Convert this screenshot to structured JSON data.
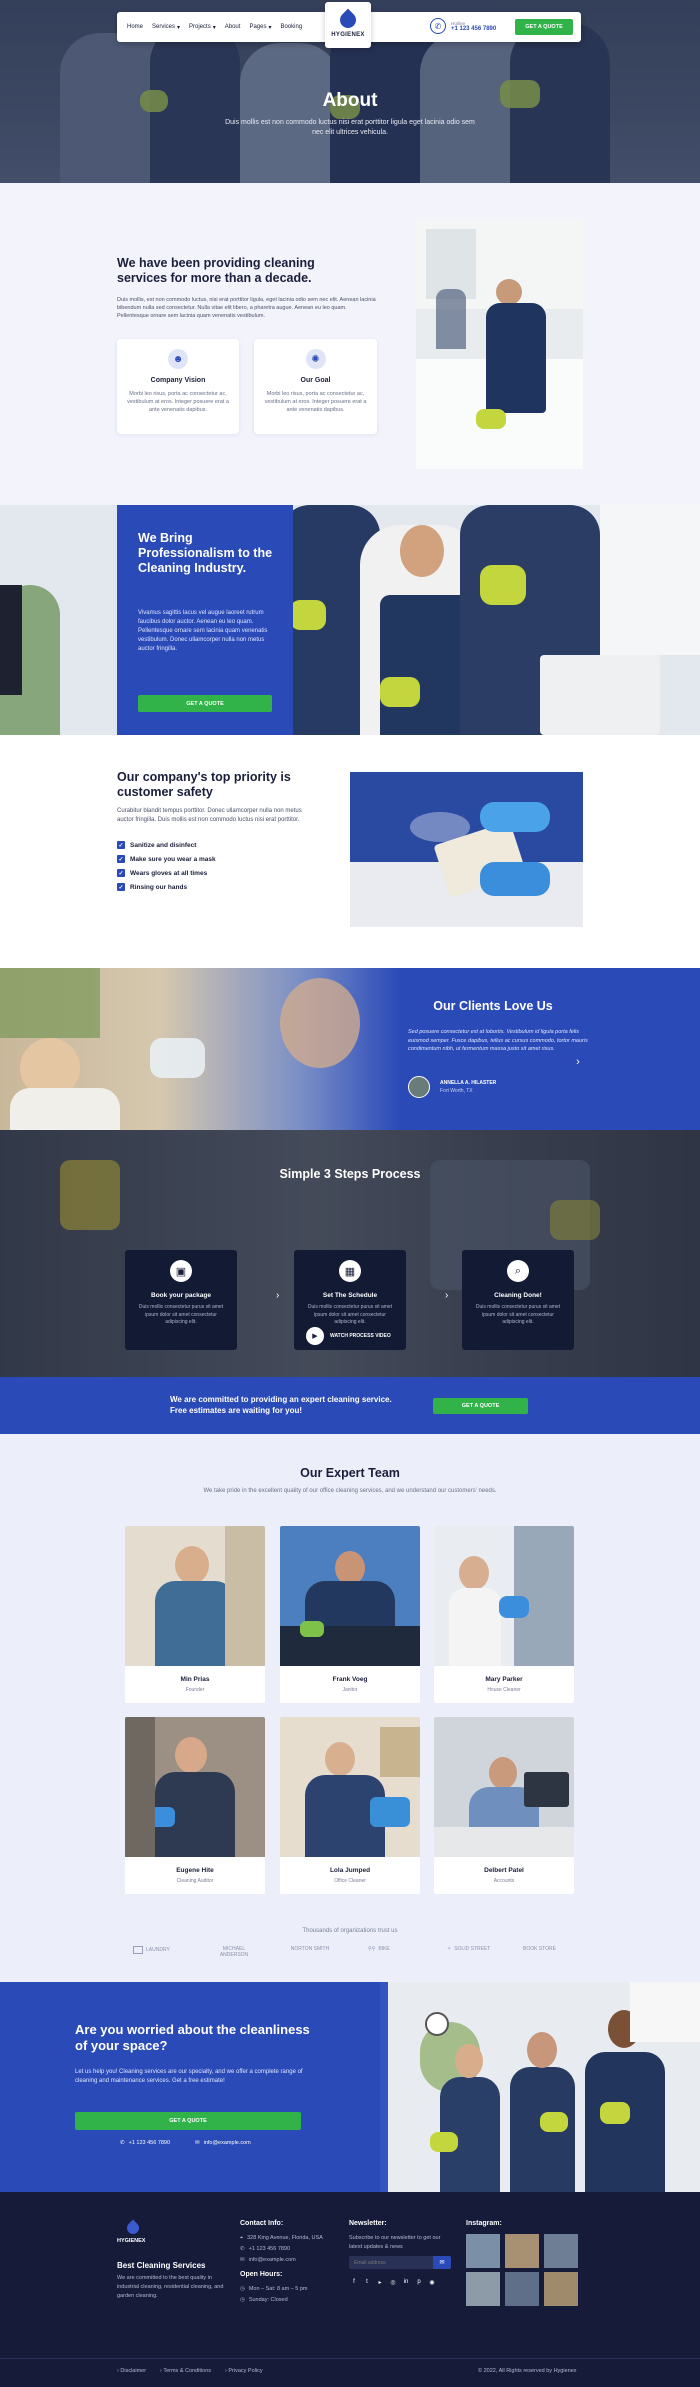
{
  "nav": {
    "items": [
      "Home",
      "Services",
      "Projects",
      "About",
      "Pages",
      "Booking"
    ],
    "logo": "HYGIENEX",
    "phone_label": "Hotline",
    "phone": "+1 123 456 7890",
    "cta": "GET A QUOTE"
  },
  "hero": {
    "title": "About",
    "subtitle": "Duis mollis est non commodo luctus nisi erat porttitor ligula eget lacinia odio sem nec elit ultrices vehicula."
  },
  "about": {
    "title": "We have been providing cleaning services for more than a decade.",
    "text": "Duis mollis, est non commodo luctus, nisi erat porttitor ligula, eget lacinia odio sem nec elit. Aenean lacinia bibendum nulla sed consectetur. Nulla vitae elit libero, a pharetra augue. Aenean eu leo quam. Pellentesque ornare sem lacinia quam venenatis vestibulum.",
    "cards": [
      {
        "title": "Company Vision",
        "text": "Morbi leo risus, porta ac consectetur ac, vestibulum at eros. Integer posuere erat a ante venenatis dapibus."
      },
      {
        "title": "Our Goal",
        "text": "Morbi leo risus, porta ac consectetur ac, vestibulum at eros. Integer posuere erat a ante venenatis dapibus."
      }
    ]
  },
  "pro": {
    "title": "We Bring Professionalism to the Cleaning Industry.",
    "text": "Vivamus sagittis lacus vel augue laoreet rutrum faucibus dolor auctor. Aenean eu leo quam. Pellentesque ornare sem lacinia quam venenatis vestibulum. Donec ullamcorper nulla non metus auctor fringilla.",
    "cta": "GET A QUOTE"
  },
  "safety": {
    "title": "Our company's top priority is customer safety",
    "text": "Curabitur blandit tempus porttitor. Donec ullamcorper nulla non metus auctor fringilla. Duis mollis est non commodo luctus nisi erat porttitor.",
    "checks": [
      "Sanitize and disinfect",
      "Make sure you wear a mask",
      "Wears gloves at all times",
      "Rinsing our hands"
    ]
  },
  "clients": {
    "title": "Our Clients Love Us",
    "quote": "Sed posuere consectetur est at lobortis. Vestibulum id ligula porta felis euismod semper. Fusce dapibus, tellus ac cursus commodo, tortor mauris condimentum nibh, ut fermentum massa justo sit amet risus.",
    "name": "ANNELLA A. HILASTER",
    "place": "Fort Worth, TX"
  },
  "steps": {
    "title": "Simple 3 Steps Process",
    "items": [
      {
        "title": "Book your package",
        "text": "Duis mollis consectetur purus sit amet ipsum dolor sit amet consectetur adipiscing elit."
      },
      {
        "title": "Set The Schedule",
        "text": "Duis mollis consectetur purus sit amet ipsum dolor sit amet consectetur adipiscing elit."
      },
      {
        "title": "Cleaning Done!",
        "text": "Duis mollis consectetur purus sit amet ipsum dolor sit amet consectetur adipiscing elit."
      }
    ],
    "video": "WATCH PROCESS VIDEO"
  },
  "cta": {
    "text": "We are committed to providing an expert cleaning service. Free estimates are waiting for you!",
    "button": "GET A QUOTE"
  },
  "team": {
    "title": "Our Expert Team",
    "subtitle": "We take pride in the excellent quality of our office cleaning services, and we understand our customers' needs.",
    "members": [
      {
        "name": "Min Prias",
        "role": "Founder"
      },
      {
        "name": "Frank Voeg",
        "role": "Janitor"
      },
      {
        "name": "Mary Parker",
        "role": "House Cleaner"
      },
      {
        "name": "Eugene Hite",
        "role": "Cleaning Auditor"
      },
      {
        "name": "Lola Jumped",
        "role": "Office Cleaner"
      },
      {
        "name": "Delbert Patel",
        "role": "Accounts"
      }
    ],
    "partners_label": "Thousands of organizations trust us",
    "partners": [
      "LAUNDRY",
      "MICHAEL ANDERSON",
      "NORTON SMITH",
      "BIKE",
      "SOLID STREET",
      "BOOK STORE"
    ]
  },
  "worried": {
    "title": "Are you worried about the cleanliness of your space?",
    "text": "Let us help you! Cleaning services are our specialty, and we offer a complete range of cleaning and maintenance services. Get a free estimate!",
    "button": "GET A QUOTE",
    "phone": "+1 123 456 7890",
    "email": "info@example.com"
  },
  "footer": {
    "logo": "HYGIENEX",
    "tagline": "Best Cleaning Services",
    "about": "We are committed to the best quality in industrial cleaning, residential cleaning, and garden cleaning.",
    "contact_title": "Contact Info:",
    "address": "328 King Avenue, Florida, USA",
    "phone": "+1 123 456 7890",
    "email": "info@example.com",
    "hours_title": "Open Hours:",
    "hours1": "Mon – Sat: 8 am – 5 pm",
    "hours2": "Sunday: Closed",
    "newsletter_title": "Newsletter:",
    "newsletter_text": "Subscribe to our newsletter to get our latest updates & news",
    "email_placeholder": "Email address",
    "instagram_title": "Instagram:",
    "links": [
      "Disclaimer",
      "Terms & Conditions",
      "Privacy Policy"
    ],
    "copyright": "© 2022, All Rights reserved by Hygienex"
  },
  "colors": {
    "primary": "#2a4ab8",
    "green": "#32b34a",
    "dark": "#161b3a"
  }
}
